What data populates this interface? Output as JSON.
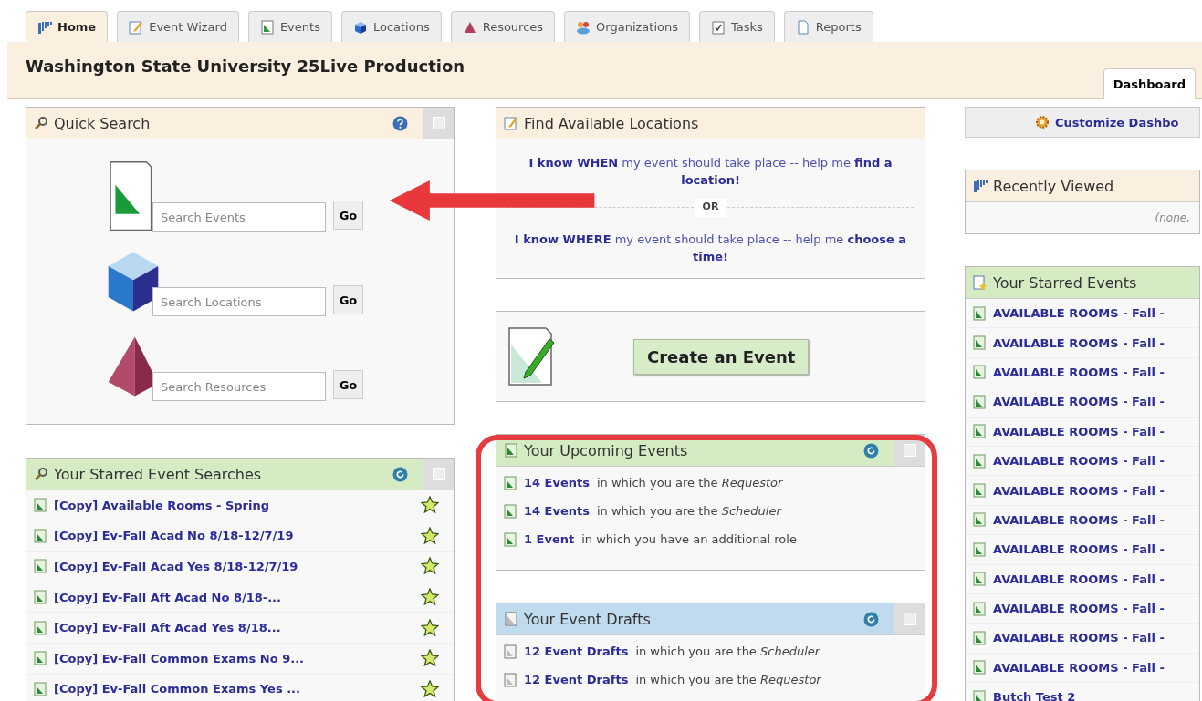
{
  "tabs": [
    {
      "label": "Home",
      "selected": true
    },
    {
      "label": "Event Wizard",
      "selected": false
    },
    {
      "label": "Events",
      "selected": false
    },
    {
      "label": "Locations",
      "selected": false
    },
    {
      "label": "Resources",
      "selected": false
    },
    {
      "label": "Organizations",
      "selected": false
    },
    {
      "label": "Tasks",
      "selected": false
    },
    {
      "label": "Reports",
      "selected": false
    }
  ],
  "header": {
    "title": "Washington State University 25Live Production",
    "subtabs": [
      {
        "label": "Dashboard",
        "selected": true
      }
    ]
  },
  "quick_search": {
    "title": "Quick Search",
    "fields": [
      {
        "kind": "events",
        "placeholder": "Search Events",
        "button": "Go"
      },
      {
        "kind": "locations",
        "placeholder": "Search Locations",
        "button": "Go"
      },
      {
        "kind": "resources",
        "placeholder": "Search Resources",
        "button": "Go"
      }
    ]
  },
  "starred_searches": {
    "title": "Your Starred Event Searches",
    "items": [
      {
        "label": "[Copy] Available Rooms - Spring",
        "starred": true
      },
      {
        "label": "[Copy] Ev-Fall Acad No 8/18-12/7/19",
        "starred": true
      },
      {
        "label": "[Copy] Ev-Fall Acad Yes 8/18-12/7/19",
        "starred": true
      },
      {
        "label": "[Copy] Ev-Fall Aft Acad No 8/18-...",
        "starred": true
      },
      {
        "label": "[Copy] Ev-Fall Aft Acad Yes 8/18...",
        "starred": true
      },
      {
        "label": "[Copy] Ev-Fall Common Exams No 9...",
        "starred": true
      },
      {
        "label": "[Copy] Ev-Fall Common Exams Yes ...",
        "starred": true
      }
    ]
  },
  "find_locations": {
    "title": "Find Available Locations",
    "options": [
      "**I know WHEN** my event should take place -- help me **find a location!**",
      "**I know WHERE** my event should take place -- help me **choose a time!**"
    ],
    "separator": "OR"
  },
  "create": {
    "button": "Create an Event"
  },
  "upcoming": {
    "title": "Your Upcoming Events",
    "items": [
      {
        "link": "14 Events",
        "text": "in which you are the *Requestor*"
      },
      {
        "link": "14 Events",
        "text": "in which you are the *Scheduler*"
      },
      {
        "link": "1 Event",
        "text": "in which you have an additional role"
      }
    ]
  },
  "drafts": {
    "title": "Your Event Drafts",
    "items": [
      {
        "link": "12 Event Drafts",
        "text": "in which you are the *Scheduler*"
      },
      {
        "link": "12 Event Drafts",
        "text": "in which you are the *Requestor*"
      }
    ]
  },
  "customize": {
    "label": "Customize Dashbo"
  },
  "recent": {
    "title": "Recently Viewed",
    "empty": "(none,"
  },
  "starred_events": {
    "title": "Your Starred Events",
    "items": [
      "AVAILABLE ROOMS - Fall -",
      "AVAILABLE ROOMS - Fall -",
      "AVAILABLE ROOMS - Fall -",
      "AVAILABLE ROOMS - Fall -",
      "AVAILABLE ROOMS - Fall -",
      "AVAILABLE ROOMS - Fall -",
      "AVAILABLE ROOMS - Fall -",
      "AVAILABLE ROOMS - Fall -",
      "AVAILABLE ROOMS - Fall -",
      "AVAILABLE ROOMS - Fall -",
      "AVAILABLE ROOMS - Fall -",
      "AVAILABLE ROOMS - Fall -",
      "AVAILABLE ROOMS - Fall -",
      "Butch Test 2"
    ]
  }
}
